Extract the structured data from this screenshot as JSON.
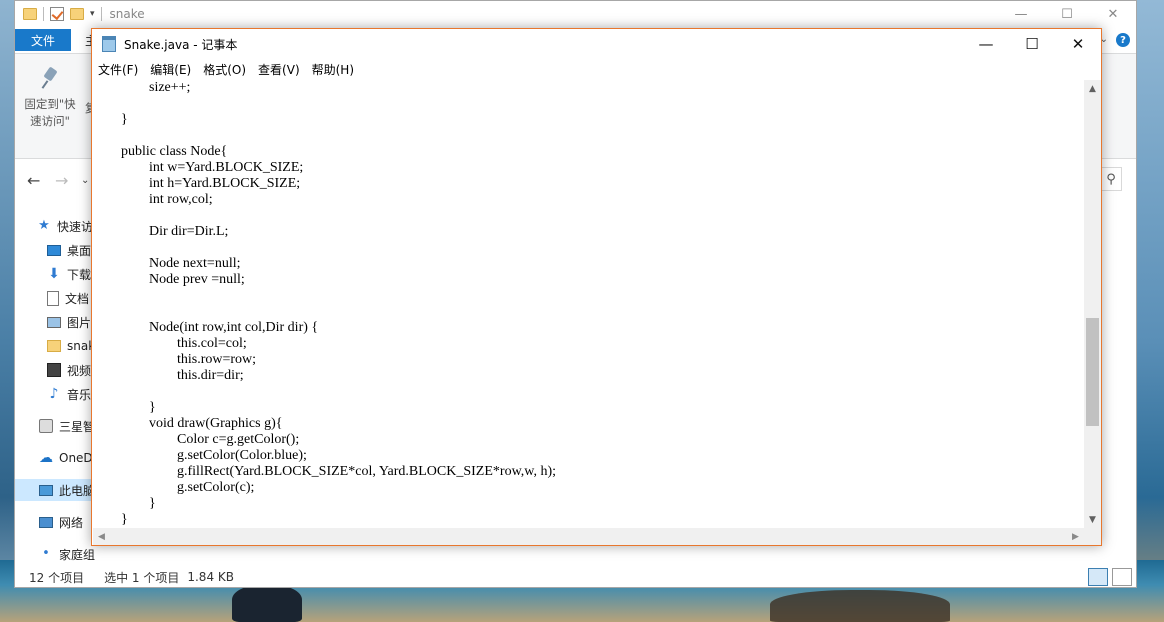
{
  "explorer": {
    "title": "snake",
    "tabs": {
      "file": "文件",
      "home": "主"
    },
    "ribbon": {
      "pin_label": "固定到\"快速访问\"",
      "copy_fragment": "复"
    },
    "nav_items": [
      {
        "label": "快速访",
        "icon": "star-icon"
      },
      {
        "label": "桌面",
        "icon": "desktop-icon"
      },
      {
        "label": "下载",
        "icon": "download-icon"
      },
      {
        "label": "文档",
        "icon": "document-icon"
      },
      {
        "label": "图片",
        "icon": "picture-icon"
      },
      {
        "label": "snak",
        "icon": "folder-icon"
      },
      {
        "label": "视频",
        "icon": "video-icon"
      },
      {
        "label": "音乐",
        "icon": "music-icon"
      },
      {
        "label": "三星智",
        "icon": "drive-icon"
      },
      {
        "label": "OneD",
        "icon": "onedrive-icon"
      },
      {
        "label": "此电脑",
        "icon": "pc-icon"
      },
      {
        "label": "网络",
        "icon": "network-icon"
      },
      {
        "label": "家庭组",
        "icon": "homegroup-icon"
      }
    ],
    "status": {
      "count": "12 个项目",
      "selected": "选中 1 个项目",
      "size": "1.84 KB"
    }
  },
  "notepad": {
    "title": "Snake.java - 记事本",
    "menu": [
      "文件(F)",
      "编辑(E)",
      "格式(O)",
      "查看(V)",
      "帮助(H)"
    ],
    "lines": [
      "                size++;",
      "",
      "        }",
      "",
      "        public class Node{",
      "                int w=Yard.BLOCK_SIZE;",
      "                int h=Yard.BLOCK_SIZE;",
      "                int row,col;",
      "",
      "                Dir dir=Dir.L;",
      "",
      "                Node next=null;",
      "                Node prev =null;",
      "",
      "",
      "                Node(int row,int col,Dir dir) {",
      "                        this.col=col;",
      "                        this.row=row;",
      "                        this.dir=dir;",
      "",
      "                }",
      "                void draw(Graphics g){",
      "                        Color c=g.getColor();",
      "                        g.setColor(Color.blue);",
      "                        g.fillRect(Yard.BLOCK_SIZE*col, Yard.BLOCK_SIZE*row,w, h);",
      "                        g.setColor(c);",
      "                }",
      "        }"
    ]
  },
  "colors": {
    "accent": "#1979ca",
    "notepad_border": "#e8772e",
    "selection": "#cce8ff"
  }
}
